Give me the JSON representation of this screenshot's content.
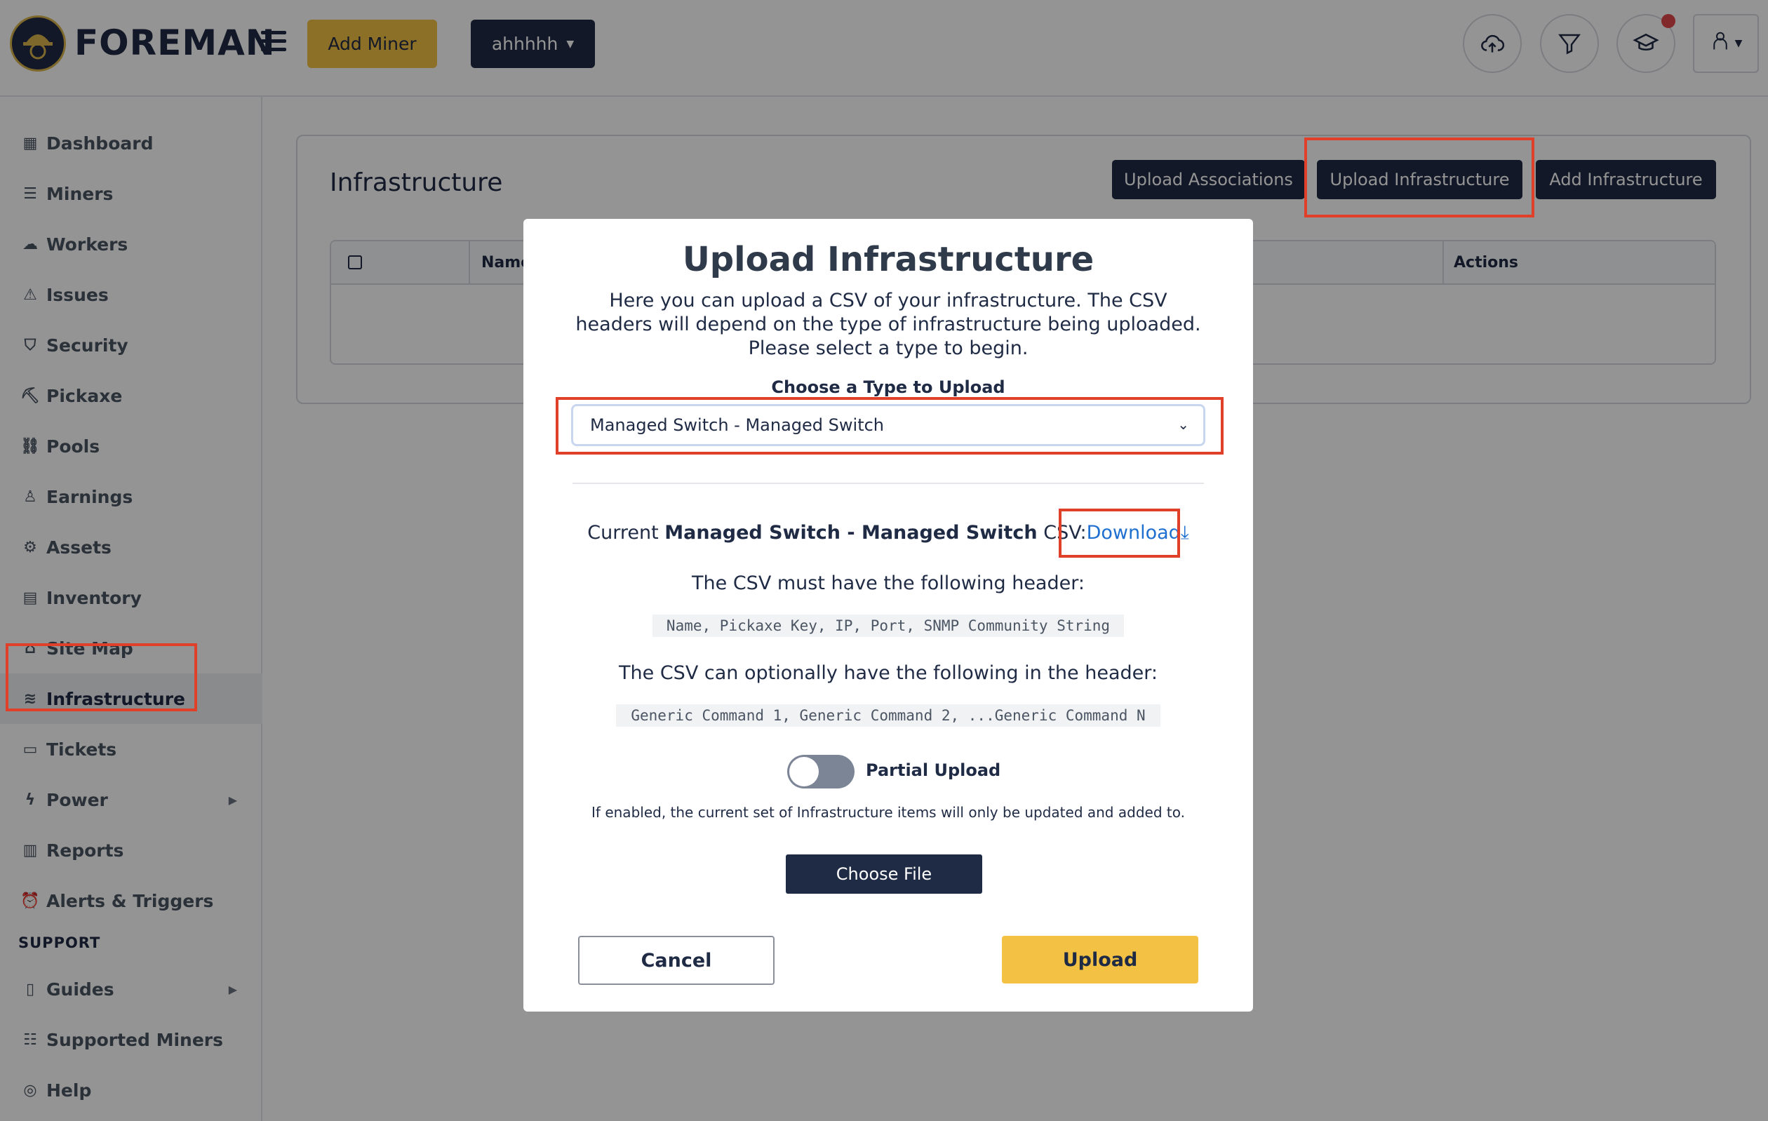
{
  "header": {
    "logo_text": "FOREMAN",
    "add_miner_label": "Add Miner",
    "org_selector_label": "ahhhhh"
  },
  "sidebar": {
    "items": [
      {
        "label": "Dashboard",
        "icon": "dashboard-icon"
      },
      {
        "label": "Miners",
        "icon": "miners-icon"
      },
      {
        "label": "Workers",
        "icon": "workers-icon"
      },
      {
        "label": "Issues",
        "icon": "warning-icon"
      },
      {
        "label": "Security",
        "icon": "shield-icon"
      },
      {
        "label": "Pickaxe",
        "icon": "pickaxe-icon"
      },
      {
        "label": "Pools",
        "icon": "pools-icon"
      },
      {
        "label": "Earnings",
        "icon": "earnings-icon"
      },
      {
        "label": "Assets",
        "icon": "gear-icon"
      },
      {
        "label": "Inventory",
        "icon": "inventory-icon"
      },
      {
        "label": "Site Map",
        "icon": "sitemap-icon"
      },
      {
        "label": "Infrastructure",
        "icon": "layers-icon"
      },
      {
        "label": "Tickets",
        "icon": "ticket-icon"
      },
      {
        "label": "Power",
        "icon": "bolt-icon"
      },
      {
        "label": "Reports",
        "icon": "report-icon"
      },
      {
        "label": "Alerts & Triggers",
        "icon": "alarm-icon"
      }
    ],
    "support_label": "SUPPORT",
    "support_items": [
      {
        "label": "Guides",
        "icon": "book-icon"
      },
      {
        "label": "Supported Miners",
        "icon": "list-icon"
      },
      {
        "label": "Help",
        "icon": "lifebuoy-icon"
      }
    ]
  },
  "page": {
    "title": "Infrastructure",
    "upload_associations_label": "Upload Associations",
    "upload_infrastructure_label": "Upload Infrastructure",
    "add_infrastructure_label": "Add Infrastructure",
    "table_headers": {
      "name": "Name",
      "actions": "Actions"
    }
  },
  "modal": {
    "title": "Upload Infrastructure",
    "intro": "Here you can upload a CSV of your infrastructure. The CSV headers will depend on the type of infrastructure being uploaded. Please select a type to begin.",
    "type_label": "Choose a Type to Upload",
    "type_selected": "Managed Switch - Managed Switch",
    "current_prefix": "Current",
    "current_type": "Managed Switch - Managed Switch",
    "current_suffix": "CSV:",
    "download_label": "Download",
    "must_header_text": "The CSV must have the following header:",
    "required_headers": "Name, Pickaxe Key, IP, Port, SNMP Community String",
    "optional_header_text": "The CSV can optionally have the following in the header:",
    "optional_headers": "Generic Command 1, Generic Command 2, ...Generic Command N",
    "partial_upload_label": "Partial Upload",
    "partial_upload_enabled": false,
    "partial_upload_hint": "If enabled, the current set of Infrastructure items will only be updated and added to.",
    "choose_file_label": "Choose File",
    "cancel_label": "Cancel",
    "upload_label": "Upload"
  },
  "colors": {
    "brand_dark": "#1f2a44",
    "brand_yellow": "#f3c244",
    "highlight_red": "#e0402a",
    "link_blue": "#1e6fcf"
  }
}
